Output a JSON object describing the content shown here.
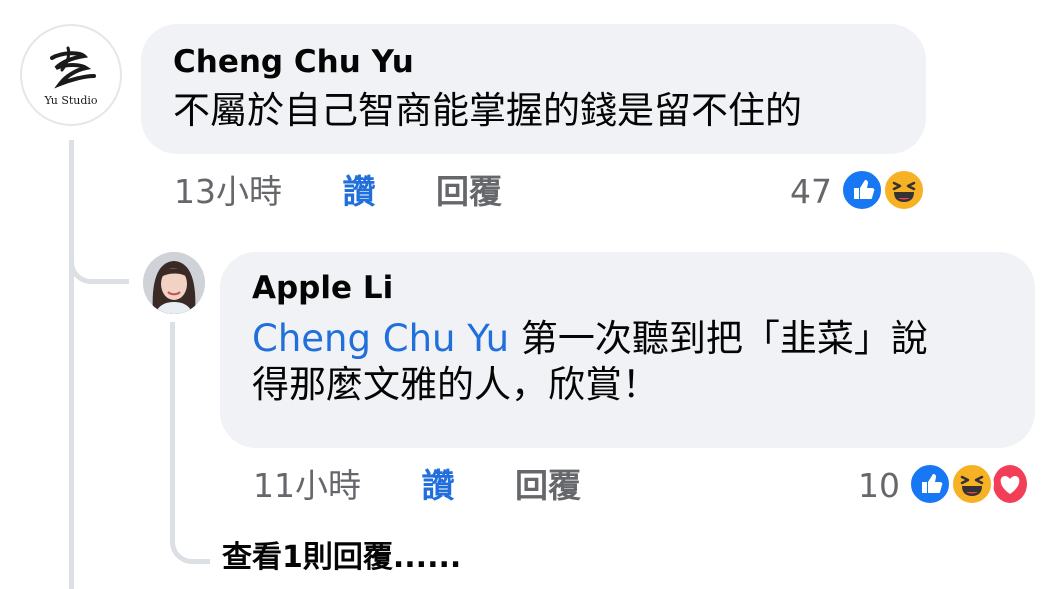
{
  "comment": {
    "author": "Cheng Chu Yu",
    "avatar_text": "Yu Studio",
    "text": "不屬於自己智商能掌握的錢是留不住的",
    "time": "13小時",
    "like_label": "讚",
    "reply_label": "回覆",
    "reaction_count": "47",
    "reactions": [
      "like-icon",
      "haha-icon"
    ]
  },
  "reply": {
    "author": "Apple Li",
    "mention": "Cheng Chu Yu",
    "text_line1": " 第一次聽到把「韭菜」說",
    "text_line2": "得那麼文雅的人，欣賞！",
    "time": "11小時",
    "like_label": "讚",
    "reply_label": "回覆",
    "reaction_count": "10",
    "reactions": [
      "like-icon",
      "haha-icon",
      "love-icon"
    ]
  },
  "view_more": "查看1則回覆......",
  "colors": {
    "bubble": "#f0f2f5",
    "mention": "#216fdb",
    "like": "#1877f2",
    "haha": "#f7b125",
    "love": "#f33e58",
    "meta": "#65676b"
  }
}
